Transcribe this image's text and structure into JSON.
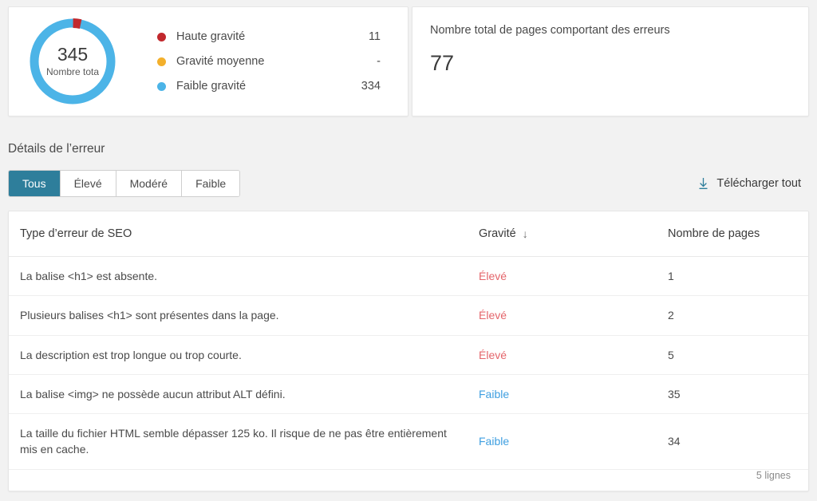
{
  "summary_card": {
    "donut": {
      "value": "345",
      "label": "Nombre tota",
      "full_label": "Nombre total",
      "segments": [
        {
          "name": "Haute gravité",
          "value": 11,
          "color": "#c1282d"
        },
        {
          "name": "Gravité moyenne",
          "value": 0,
          "color": "#f3b02c"
        },
        {
          "name": "Faible gravité",
          "value": 334,
          "color": "#4cb4e7"
        }
      ],
      "total": 345
    },
    "legend": [
      {
        "label": "Haute gravité",
        "value": "11",
        "color": "#c1282d",
        "icon": "severity-dot-high"
      },
      {
        "label": "Gravité moyenne",
        "value": "-",
        "color": "#f3b02c",
        "icon": "severity-dot-medium"
      },
      {
        "label": "Faible gravité",
        "value": "334",
        "color": "#4cb4e7",
        "icon": "severity-dot-low"
      }
    ]
  },
  "total_pages_card": {
    "title": "Nombre total de pages comportant des erreurs",
    "value": "77"
  },
  "details_section": {
    "title": "Détails de l’erreur",
    "tabs": [
      {
        "label": "Tous",
        "active": true
      },
      {
        "label": "Élevé",
        "active": false
      },
      {
        "label": "Modéré",
        "active": false
      },
      {
        "label": "Faible",
        "active": false
      }
    ],
    "download": {
      "label": "Télécharger tout",
      "icon": "download-arrow-icon"
    }
  },
  "table": {
    "columns": [
      {
        "label": "Type d’erreur de SEO",
        "sorted": false
      },
      {
        "label": "Gravité",
        "sorted": true,
        "sort_icon": "↓"
      },
      {
        "label": "Nombre de pages",
        "sorted": false
      }
    ],
    "rows": [
      {
        "type": "La balise <h1> est absente.",
        "severity": "Élevé",
        "severity_class": "sev-high",
        "pages": "1"
      },
      {
        "type": "Plusieurs balises <h1> sont présentes dans la page.",
        "severity": "Élevé",
        "severity_class": "sev-high",
        "pages": "2"
      },
      {
        "type": "La description est trop longue ou trop courte.",
        "severity": "Élevé",
        "severity_class": "sev-high",
        "pages": "5"
      },
      {
        "type": "La balise <img> ne possède aucun attribut ALT défini.",
        "severity": "Faible",
        "severity_class": "sev-low",
        "pages": "35"
      },
      {
        "type": "La taille du fichier HTML semble dépasser 125 ko. Il risque de ne pas être entièrement mis en cache.",
        "severity": "Faible",
        "severity_class": "sev-low",
        "pages": "34"
      }
    ],
    "footer": {
      "rows_count": "5 lignes"
    }
  },
  "colors": {
    "accent_teal": "#2e7e9b",
    "severity_high": "#e4646a",
    "severity_low": "#3f9fe0",
    "donut_low": "#4cb4e7",
    "donut_high": "#c1282d",
    "page_background": "#f2f2f2",
    "card_background": "#ffffff"
  }
}
